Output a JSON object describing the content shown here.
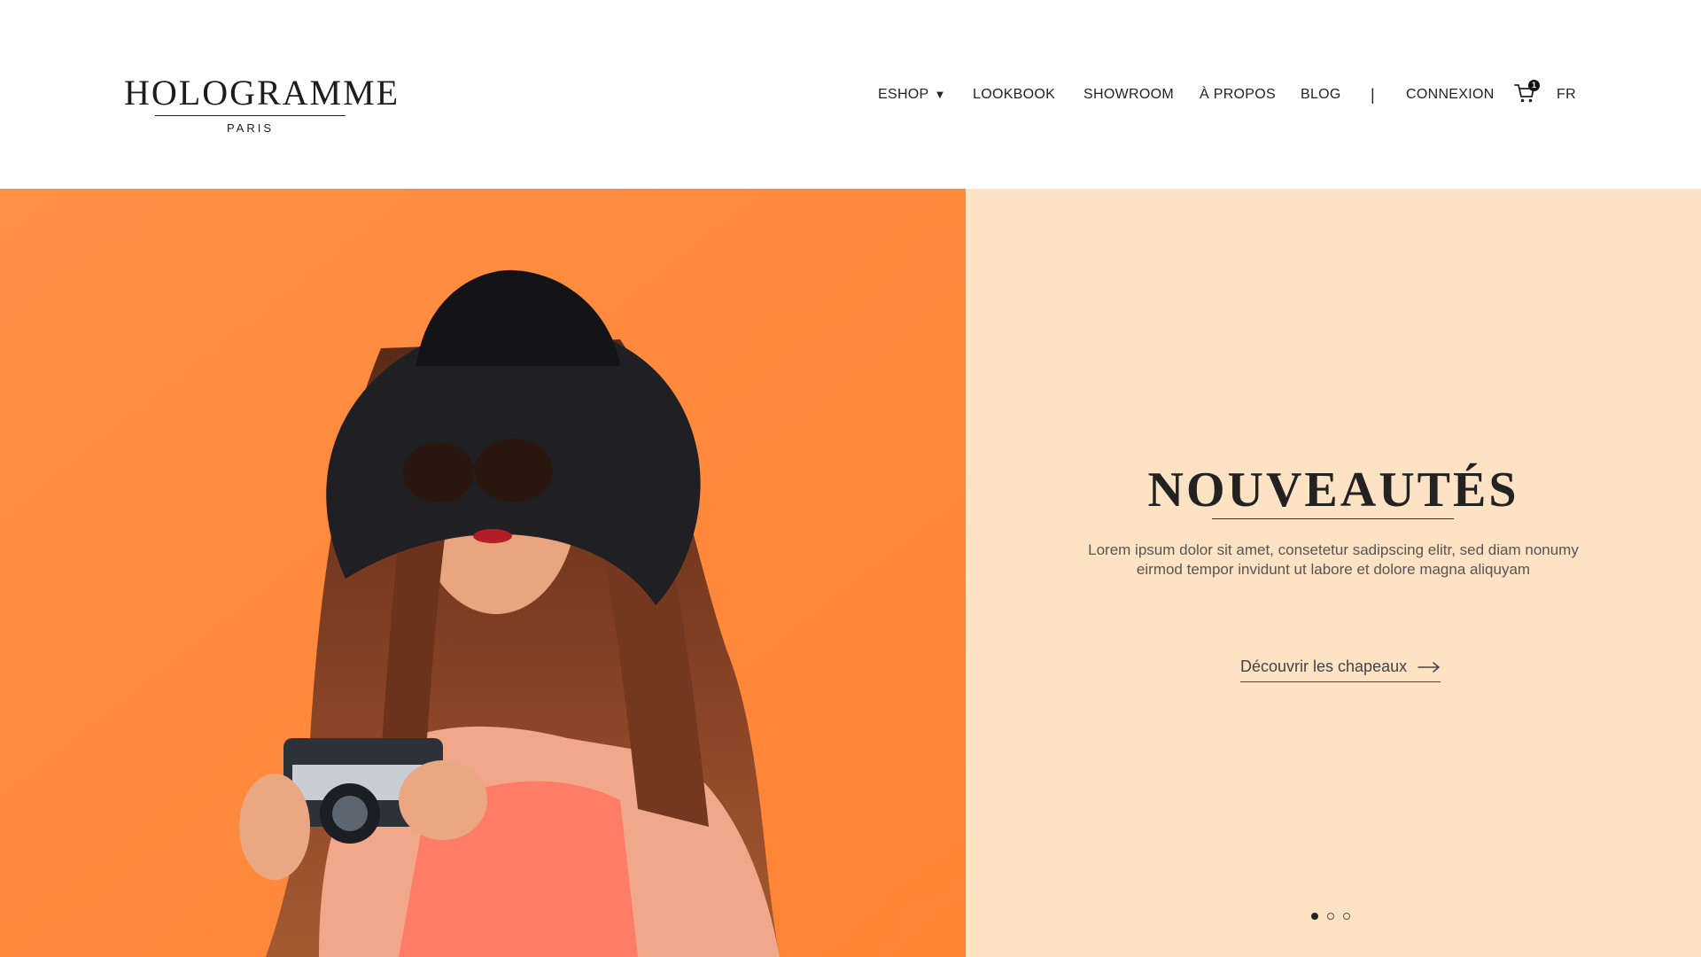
{
  "brand": {
    "name": "HOLOGRAMME",
    "subtitle": "PARIS"
  },
  "nav": {
    "items": [
      {
        "label": "ESHOP",
        "has_dropdown": true,
        "caret": "▼"
      },
      {
        "label": "LOOKBOOK"
      },
      {
        "label": "SHOWROOM"
      },
      {
        "label": "À PROPOS"
      },
      {
        "label": "BLOG"
      }
    ],
    "separator": "|",
    "login": "CONNEXION",
    "cart_count": "1",
    "cart_icon": "shopping-cart-icon",
    "language": "FR"
  },
  "hero": {
    "title": "NOUVEAUTÉS",
    "text": "Lorem ipsum dolor sit amet, consetetur sadipscing elitr, sed diam nonumy eirmod tempor invidunt ut labore et dolore magna aliquyam",
    "cta": "Découvrir les chapeaux",
    "cta_icon": "arrow-right-icon",
    "slides": 3,
    "active_slide": 1
  },
  "colors": {
    "image_background": "#ff8a3d",
    "panel_background": "#fde2c4",
    "text_dark": "#222222"
  }
}
